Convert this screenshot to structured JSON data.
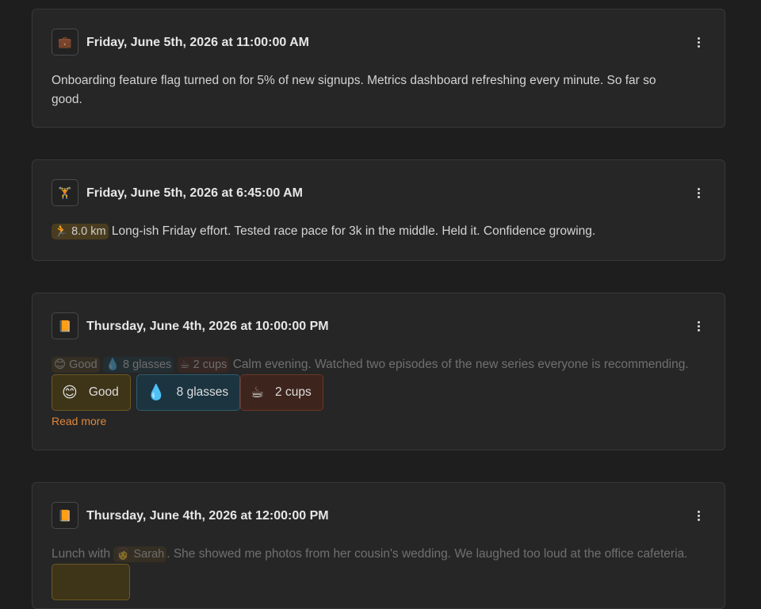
{
  "entries": [
    {
      "icon": "💼",
      "icon_name": "briefcase-icon",
      "timestamp": "Friday, June 5th, 2026 at 11:00:00 AM",
      "text_line1": "Onboarding feature flag turned on for 5% of new signups. Metrics dashboard refreshing every minute. So far so",
      "text_line2": "good."
    },
    {
      "icon": "🏋",
      "icon_name": "weightlifter-icon",
      "timestamp": "Friday, June 5th, 2026 at 6:45:00 AM",
      "tag": {
        "emoji": "🏃",
        "label": "8.0 km"
      },
      "text": "Long-ish Friday effort. Tested race pace for 3k in the middle. Held it. Confidence growing."
    },
    {
      "icon": "📙",
      "icon_name": "notebook-icon",
      "timestamp": "Thursday, June 4th, 2026 at 10:00:00 PM",
      "tags": [
        {
          "emoji": "😊",
          "label": "Good"
        },
        {
          "emoji": "💧",
          "label": "8 glasses"
        },
        {
          "emoji": "☕",
          "label": "2 cups"
        }
      ],
      "text": "Calm evening. Watched two episodes of the new series everyone is recommending.",
      "read_more": "Read more"
    },
    {
      "icon": "📙",
      "icon_name": "notebook-icon",
      "timestamp": "Thursday, June 4th, 2026 at 12:00:00 PM",
      "text_before": "Lunch with",
      "mention": {
        "emoji": "👩",
        "label": "Sarah"
      },
      "text_after": ". She showed me photos from her cousin's wedding. We laughed too loud at the office cafeteria."
    }
  ]
}
